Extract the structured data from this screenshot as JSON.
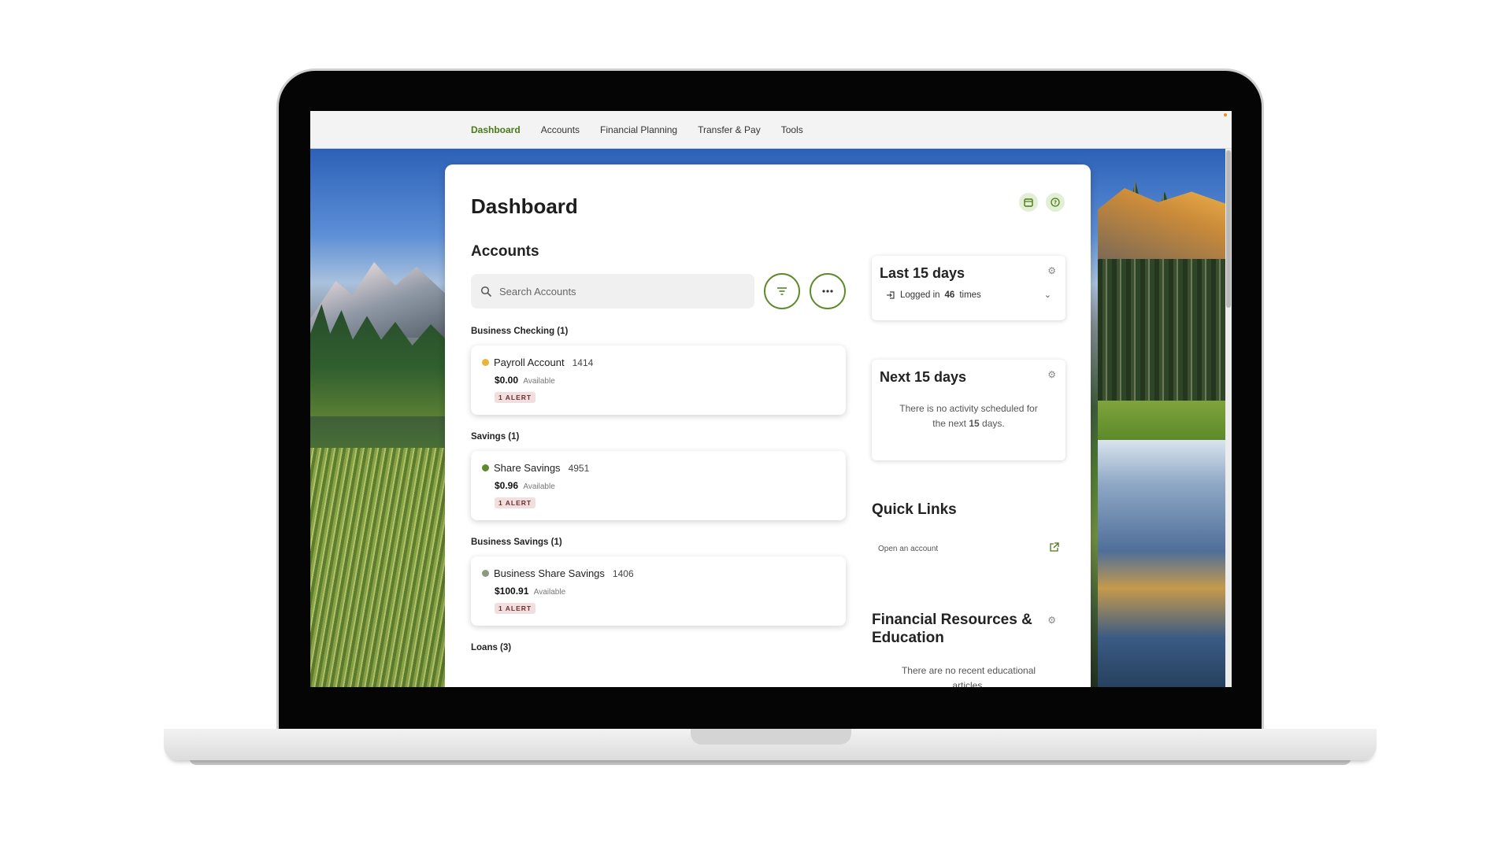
{
  "nav": {
    "items": [
      {
        "label": "Dashboard",
        "active": true
      },
      {
        "label": "Accounts",
        "active": false
      },
      {
        "label": "Financial Planning",
        "active": false
      },
      {
        "label": "Transfer & Pay",
        "active": false
      },
      {
        "label": "Tools",
        "active": false
      }
    ]
  },
  "page": {
    "title": "Dashboard",
    "icons": [
      "calendar-icon",
      "help-icon"
    ]
  },
  "accounts": {
    "title": "Accounts",
    "search_placeholder": "Search Accounts",
    "filter_icon": "filter-icon",
    "more_icon": "more-icon",
    "groups": [
      {
        "label": "Business Checking (1)",
        "accounts": [
          {
            "name": "Payroll Account",
            "number": "1414",
            "balance": "$0.00",
            "available_label": "Available",
            "alert": "1 ALERT",
            "status_color": "#e9b33c"
          }
        ]
      },
      {
        "label": "Savings (1)",
        "accounts": [
          {
            "name": "Share Savings",
            "number": "4951",
            "balance": "$0.96",
            "available_label": "Available",
            "alert": "1 ALERT",
            "status_color": "#5d8a2a"
          }
        ]
      },
      {
        "label": "Business Savings (1)",
        "accounts": [
          {
            "name": "Business Share Savings",
            "number": "1406",
            "balance": "$100.91",
            "available_label": "Available",
            "alert": "1 ALERT",
            "status_color": "#8a9a82"
          }
        ]
      },
      {
        "label": "Loans (3)",
        "accounts": []
      }
    ]
  },
  "last15": {
    "title": "Last 15 days",
    "login_prefix": "Logged in",
    "login_count": "46",
    "login_suffix": "times"
  },
  "next15": {
    "title": "Next 15 days",
    "empty_line1": "There is no activity scheduled for",
    "empty_prefix": "the next",
    "empty_count": "15",
    "empty_suffix": "days."
  },
  "quick_links": {
    "title": "Quick Links",
    "items": [
      {
        "label": "Open an account"
      }
    ]
  },
  "financial_resources": {
    "title": "Financial Resources & Education",
    "empty_text": "There are no recent educational articles."
  },
  "colors": {
    "accent": "#4a7a17",
    "accent_ring": "#5d8a2a"
  }
}
